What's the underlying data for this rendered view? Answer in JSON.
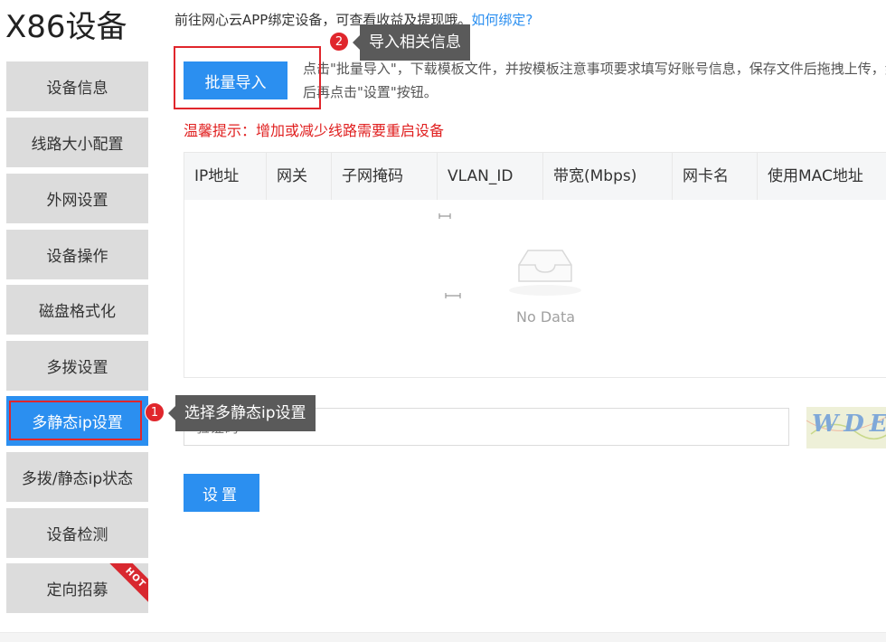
{
  "page": {
    "title": "X86设备"
  },
  "sidebar": {
    "items": [
      {
        "label": "设备信息",
        "active": false
      },
      {
        "label": "线路大小配置",
        "active": false
      },
      {
        "label": "外网设置",
        "active": false
      },
      {
        "label": "设备操作",
        "active": false
      },
      {
        "label": "磁盘格式化",
        "active": false
      },
      {
        "label": "多拨设置",
        "active": false
      },
      {
        "label": "多静态ip设置",
        "active": true
      },
      {
        "label": "多拨/静态ip状态",
        "active": false
      },
      {
        "label": "设备检测",
        "active": false
      },
      {
        "label": "定向招募",
        "active": false,
        "badge": "HOT"
      }
    ]
  },
  "notice": {
    "text": "前往网心云APP绑定设备，可查看收益及提现哦。",
    "link": "如何绑定?"
  },
  "import": {
    "button_label": "批量导入",
    "description": "点击\"批量导入\"，下载模板文件，并按模板注意事项要求填写好账号信息，保存文件后拖拽上传，然后再点击\"设置\"按钮。"
  },
  "warning": "温馨提示：增加或减少线路需要重启设备",
  "table": {
    "columns": [
      "IP地址",
      "网关",
      "子网掩码",
      "VLAN_ID",
      "带宽(Mbps)",
      "网卡名",
      "使用MAC地址"
    ],
    "empty_text": "No Data"
  },
  "captcha": {
    "placeholder": "验证码",
    "image_text": "WDE"
  },
  "submit": {
    "label": "设置"
  },
  "annotations": {
    "step1": {
      "number": "1",
      "text": "选择多静态ip设置"
    },
    "step2": {
      "number": "2",
      "text": "导入相关信息"
    }
  },
  "colors": {
    "primary": "#2b8ff0",
    "danger": "#e02020",
    "sidebar_bg": "#dcdcdc",
    "hot": "#d8282f"
  }
}
